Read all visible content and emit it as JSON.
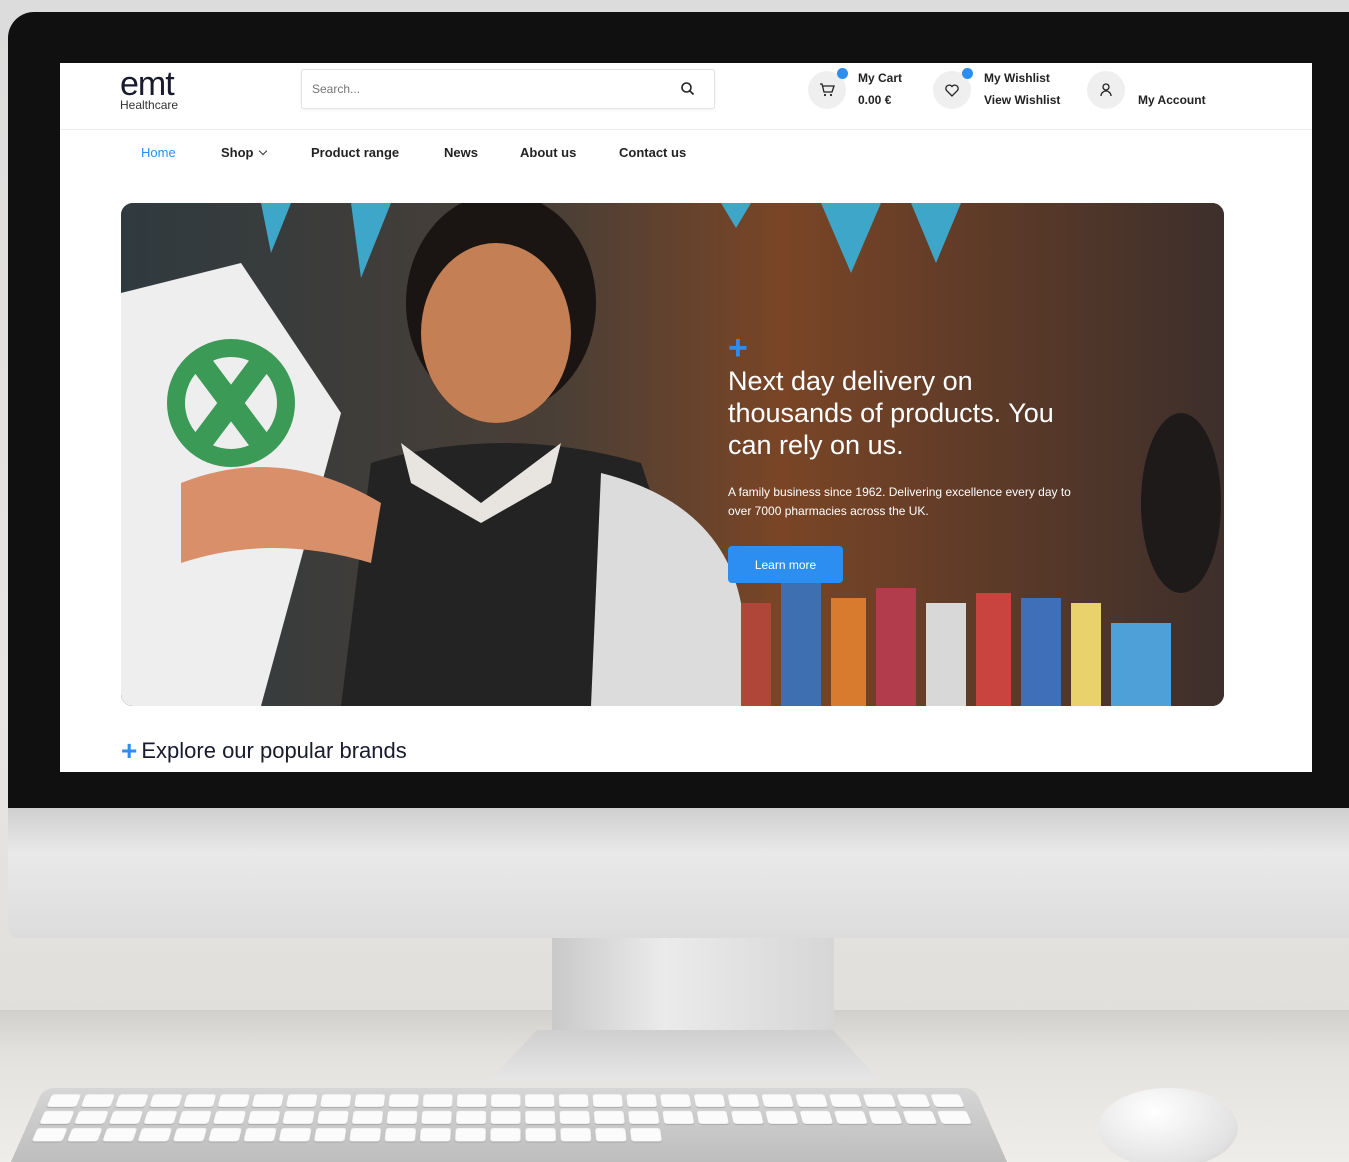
{
  "logo": {
    "main": "emt",
    "sub": "Healthcare"
  },
  "search": {
    "placeholder": "Search..."
  },
  "header": {
    "cart_title": "My Cart",
    "cart_total": "0.00 €",
    "wishlist_title": "My Wishlist",
    "wishlist_link": "View Wishlist",
    "account_label": "My Account"
  },
  "nav": {
    "items": [
      {
        "label": "Home"
      },
      {
        "label": "Shop"
      },
      {
        "label": "Product range"
      },
      {
        "label": "News"
      },
      {
        "label": "About us"
      },
      {
        "label": "Contact us"
      }
    ]
  },
  "hero": {
    "plus": "+",
    "title": "Next day delivery on thousands of products. You can rely on us.",
    "subtitle": "A family business since 1962. Delivering excellence every day to over 7000 pharmacies across the UK.",
    "button_label": "Learn more"
  },
  "section": {
    "plus": "+",
    "title": "Explore our popular brands"
  },
  "colors": {
    "accent": "#2b8ef0",
    "text": "#1a1a2e"
  },
  "icons": [
    "search-icon",
    "cart-icon",
    "heart-icon",
    "user-icon",
    "chevron-down-icon",
    "plus-icon"
  ]
}
